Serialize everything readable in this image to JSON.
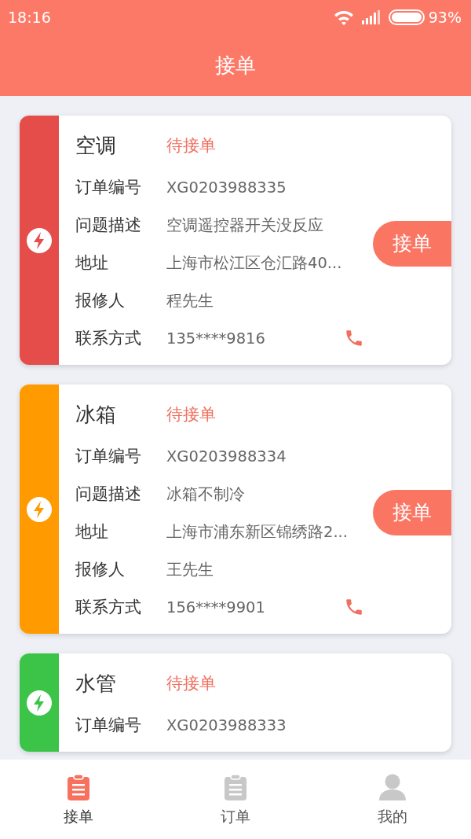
{
  "status_bar": {
    "time": "18:16",
    "battery": "93%"
  },
  "header": {
    "title": "接单"
  },
  "orders": [
    {
      "category": "空调",
      "status": "待接单",
      "color": "#e44d4a",
      "action": "接单",
      "fields": [
        {
          "label": "订单编号",
          "value": "XG0203988335"
        },
        {
          "label": "问题描述",
          "value": "空调遥控器开关没反应"
        },
        {
          "label": "地址",
          "value": "上海市松江区仓汇路40..."
        },
        {
          "label": "报修人",
          "value": "程先生"
        },
        {
          "label": "联系方式",
          "value": "135****9816",
          "kind": "phone"
        }
      ]
    },
    {
      "category": "冰箱",
      "status": "待接单",
      "color": "#ff9a00",
      "action": "接单",
      "fields": [
        {
          "label": "订单编号",
          "value": "XG0203988334"
        },
        {
          "label": "问题描述",
          "value": "冰箱不制冷"
        },
        {
          "label": "地址",
          "value": "上海市浦东新区锦绣路2..."
        },
        {
          "label": "报修人",
          "value": "王先生"
        },
        {
          "label": "联系方式",
          "value": "156****9901",
          "kind": "phone"
        }
      ]
    },
    {
      "category": "水管",
      "status": "待接单",
      "color": "#3cc448",
      "fields": [
        {
          "label": "订单编号",
          "value": "XG0203988333"
        }
      ]
    }
  ],
  "tabs": [
    {
      "label": "接单",
      "selected": true,
      "kind": "clipboard"
    },
    {
      "label": "订单",
      "selected": false,
      "kind": "clipboard"
    },
    {
      "label": "我的",
      "selected": false,
      "kind": "person"
    }
  ]
}
